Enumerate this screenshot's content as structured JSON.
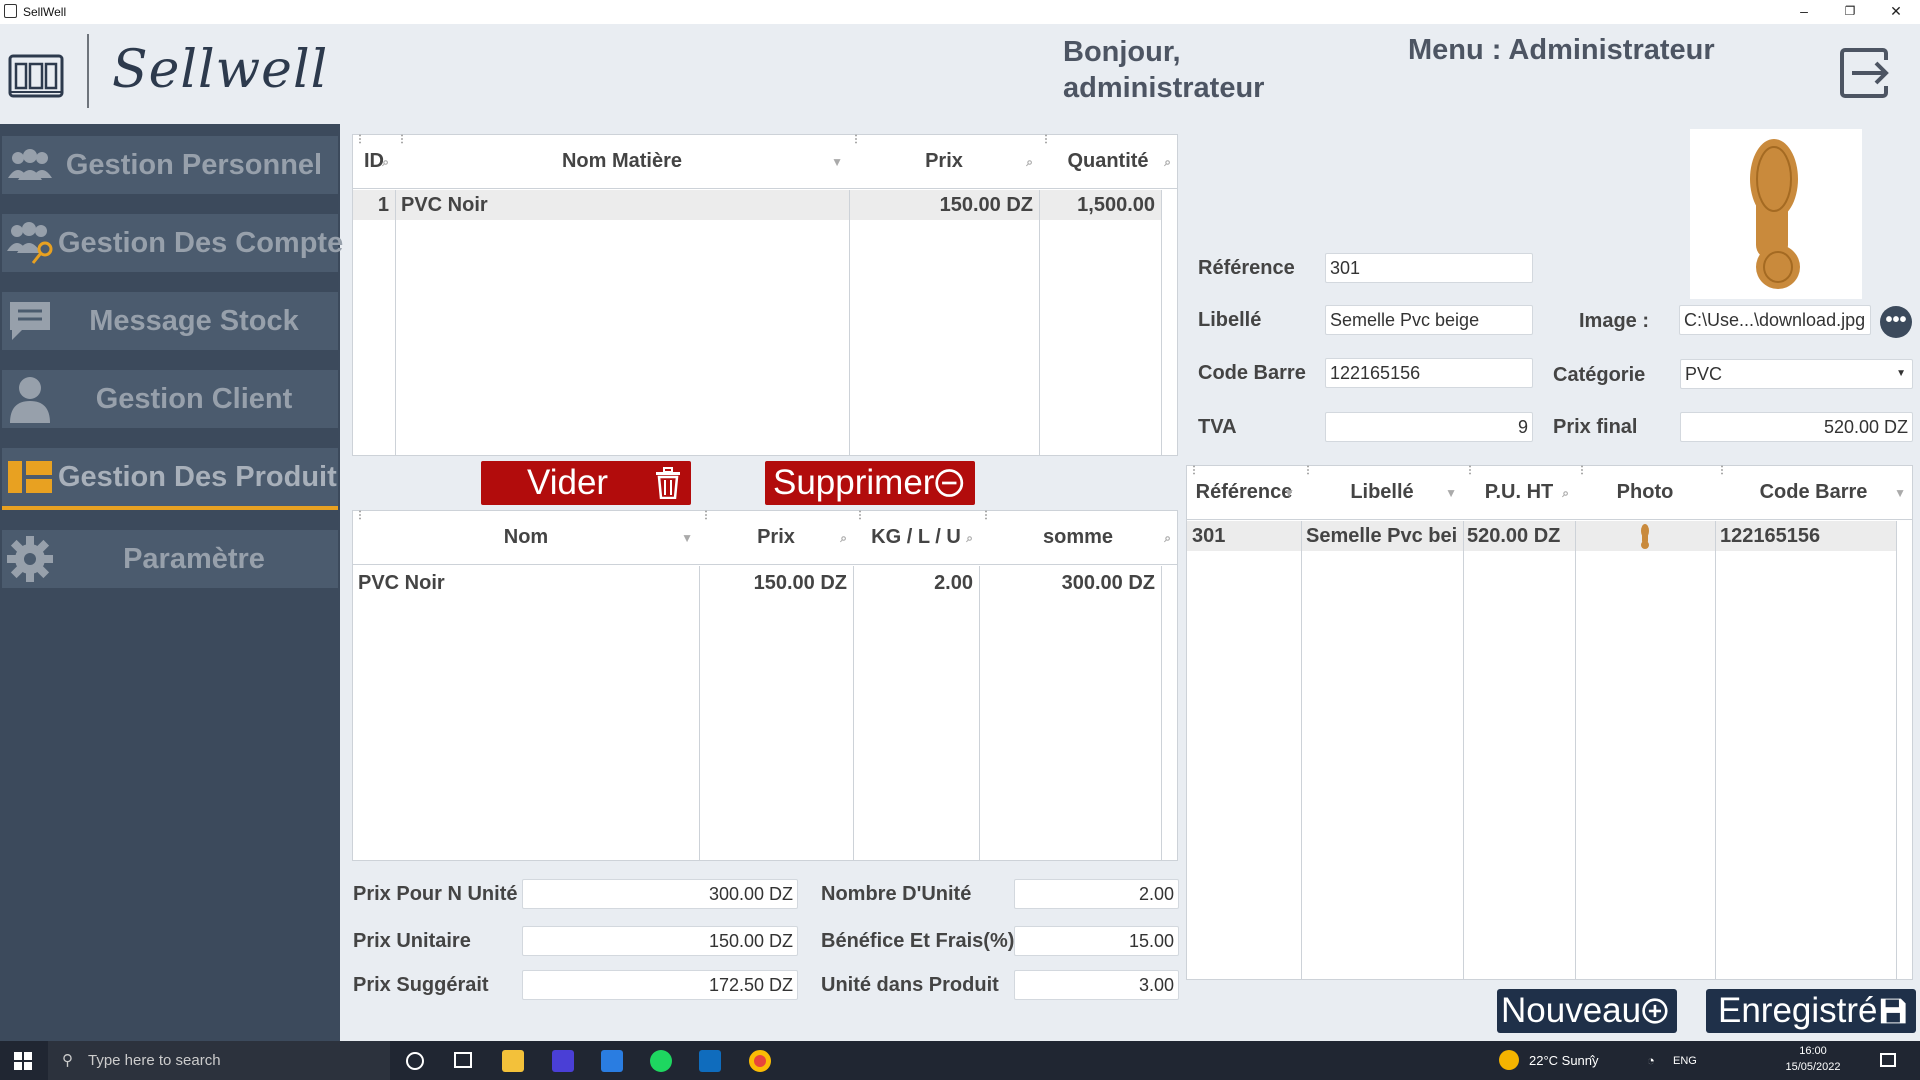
{
  "window": {
    "title": "SellWell",
    "minimize": "–",
    "restore": "❐",
    "close": "✕"
  },
  "header": {
    "logo_text": "Sellwell",
    "greeting_line1": "Bonjour,",
    "greeting_line2": "administrateur",
    "menu_title": "Menu : Administrateur"
  },
  "sidebar": {
    "items": [
      {
        "label": "Gestion Personnel",
        "icon": "users-icon"
      },
      {
        "label": "Gestion Des Compte",
        "icon": "users-key-icon"
      },
      {
        "label": "Message Stock",
        "icon": "message-icon"
      },
      {
        "label": "Gestion Client",
        "icon": "user-icon"
      },
      {
        "label": "Gestion Des Produit",
        "icon": "layout-icon",
        "active": true
      },
      {
        "label": "Paramètre",
        "icon": "gear-icon"
      }
    ]
  },
  "materials_table": {
    "columns": [
      "ID",
      "Nom Matière",
      "Prix",
      "Quantité"
    ],
    "rows": [
      {
        "id": "1",
        "nom": "PVC Noir",
        "prix": "150.00 DZ",
        "quantite": "1,500.00"
      }
    ]
  },
  "buttons": {
    "vider": "Vider",
    "supprimer": "Supprimer",
    "nouveau": "Nouveau",
    "enregistre": "Enregistré"
  },
  "composition_table": {
    "columns": [
      "Nom",
      "Prix",
      "KG / L / U",
      "somme"
    ],
    "rows": [
      {
        "nom": "PVC Noir",
        "prix": "150.00 DZ",
        "kg": "2.00",
        "somme": "300.00 DZ"
      }
    ]
  },
  "calc": {
    "prix_pour_n_unite_label": "Prix Pour N Unité",
    "prix_pour_n_unite": "300.00 DZ",
    "prix_unitaire_label": "Prix Unitaire",
    "prix_unitaire": "150.00 DZ",
    "prix_suggere_label": "Prix Suggérait",
    "prix_suggere": "172.50 DZ",
    "nombre_unite_label": "Nombre D'Unité",
    "nombre_unite": "2.00",
    "benefice_label": "Bénéfice Et Frais(%)",
    "benefice": "15.00",
    "unite_produit_label": "Unité dans Produit",
    "unite_produit": "3.00"
  },
  "product_form": {
    "reference_label": "Référence",
    "reference": "301",
    "libelle_label": "Libellé",
    "libelle": "Semelle Pvc beige",
    "code_barre_label": "Code Barre",
    "code_barre": "122165156",
    "tva_label": "TVA",
    "tva": "9",
    "image_label": "Image :",
    "image_path": "C:\\Use...\\download.jpg",
    "categorie_label": "Catégorie",
    "categorie": "PVC",
    "prix_final_label": "Prix final",
    "prix_final": "520.00 DZ"
  },
  "products_table": {
    "columns": [
      "Référence",
      "Libellé",
      "P.U. HT",
      "Photo",
      "Code Barre"
    ],
    "rows": [
      {
        "reference": "301",
        "libelle": "Semelle Pvc bei",
        "pu": "520.00 DZ",
        "code_barre": "122165156"
      }
    ]
  },
  "taskbar": {
    "search_placeholder": "Type here to search",
    "weather": "22°C  Sunny",
    "lang": "ENG",
    "time": "16:00",
    "date": "15/05/2022"
  },
  "colors": {
    "sidebar": "#3c4a5c",
    "nav_button": "#4b5b6e",
    "accent": "#e8a121",
    "red_button": "#b20c0c",
    "navy_button": "#1f3049"
  }
}
